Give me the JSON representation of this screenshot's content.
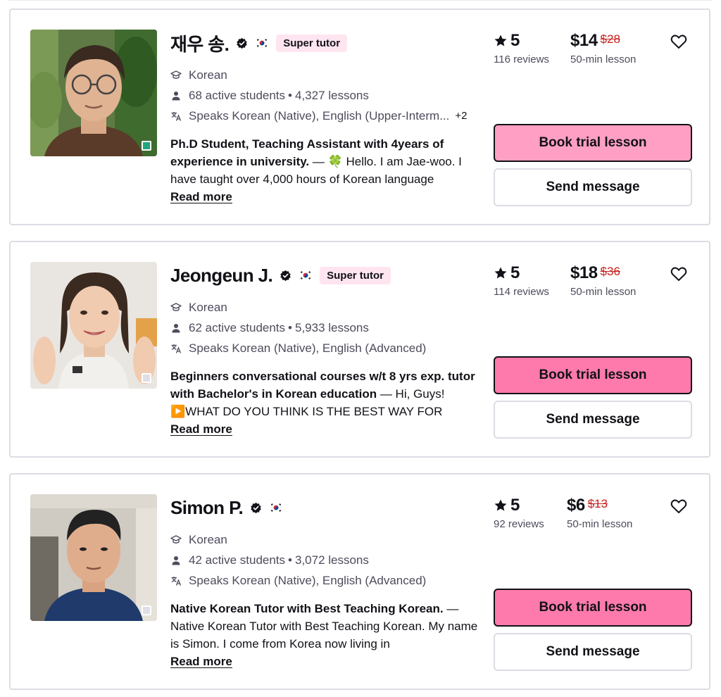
{
  "colors": {
    "book_button_light": "#ff9fc4",
    "book_button": "#ff7aac",
    "badge_bg": "#ffe5f0",
    "old_price": "#c5221f",
    "online_green": "#1fa77f"
  },
  "icons": {
    "verified": "verified-check-icon",
    "flag": "south-korea-flag-icon",
    "subject": "graduation-cap-icon",
    "students": "person-icon",
    "languages": "translate-icon",
    "rating": "star-icon",
    "favorite": "heart-outline-icon"
  },
  "tutors": [
    {
      "name": "재우 송.",
      "badge": "Super tutor",
      "subject": "Korean",
      "students": "68 active students",
      "lessons": "4,327 lessons",
      "languages": "Speaks Korean (Native), English (Upper-Interm...",
      "languages_extra": "+2",
      "headline": "Ph.D Student, Teaching Assistant with 4years of experience in university.",
      "description": " — 🍀 Hello. I am Jae-woo. I have taught over 4,000 hours of Korean language",
      "read_more": "Read more",
      "rating": "5",
      "reviews": "116 reviews",
      "price": "$14",
      "old_price": "$28",
      "lesson_length": "50-min lesson",
      "book_label": "Book trial lesson",
      "message_label": "Send message",
      "online": true
    },
    {
      "name": "Jeongeun J.",
      "badge": "Super tutor",
      "subject": "Korean",
      "students": "62 active students",
      "lessons": "5,933 lessons",
      "languages": "Speaks Korean (Native), English (Advanced)",
      "headline": "Beginners conversational courses w/t 8 yrs exp. tutor with Bachelor's in Korean education",
      "description": " — Hi, Guys! ▶️WHAT DO YOU THINK IS THE BEST WAY FOR",
      "read_more": "Read more",
      "rating": "5",
      "reviews": "114 reviews",
      "price": "$18",
      "old_price": "$36",
      "lesson_length": "50-min lesson",
      "book_label": "Book trial lesson",
      "message_label": "Send message",
      "online": false
    },
    {
      "name": "Simon P.",
      "subject": "Korean",
      "students": "42 active students",
      "lessons": "3,072 lessons",
      "languages": "Speaks Korean (Native), English (Advanced)",
      "headline": "Native Korean Tutor with Best Teaching Korean.",
      "description": " — Native Korean Tutor with Best Teaching Korean. My name is Simon. I come from Korea now living in",
      "read_more": "Read more",
      "rating": "5",
      "reviews": "92 reviews",
      "price": "$6",
      "old_price": "$13",
      "lesson_length": "50-min lesson",
      "book_label": "Book trial lesson",
      "message_label": "Send message",
      "online": false
    }
  ]
}
